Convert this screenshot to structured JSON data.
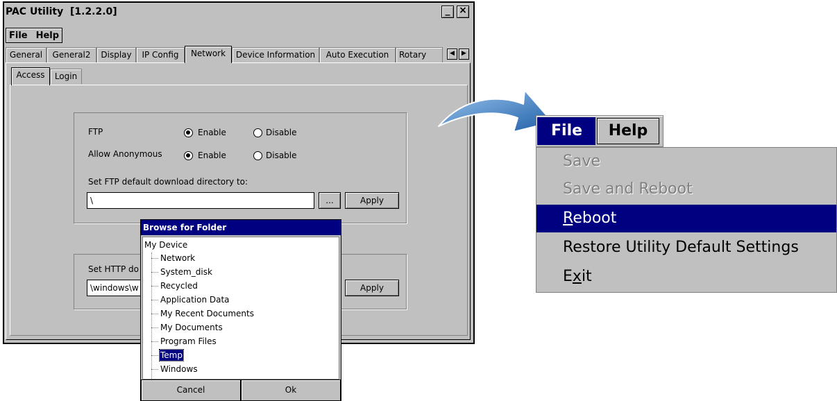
{
  "window": {
    "title": "PAC Utility  [1.2.2.0]",
    "minimize_glyph": "_",
    "close_glyph": "×"
  },
  "menubar": {
    "file": "File",
    "help": "Help"
  },
  "tabs": [
    {
      "label": "General",
      "active": false
    },
    {
      "label": "General2",
      "active": false
    },
    {
      "label": "Display",
      "active": false
    },
    {
      "label": "IP Config",
      "active": false
    },
    {
      "label": "Network",
      "active": true
    },
    {
      "label": "Device Information",
      "active": false
    },
    {
      "label": "Auto Execution",
      "active": false
    },
    {
      "label": "Rotary Exe",
      "active": false
    }
  ],
  "tab_scroll": {
    "left_glyph": "◀",
    "right_glyph": "▶"
  },
  "subtabs": [
    {
      "label": "Access",
      "active": true
    },
    {
      "label": "Login",
      "active": false
    }
  ],
  "ftp_group": {
    "ftp_label": "FTP",
    "anon_label": "Allow Anonymous",
    "enable_label": "Enable",
    "disable_label": "Disable",
    "ftp_enabled": true,
    "anonymous_enabled": true,
    "dir_label": "Set FTP default download directory to:",
    "dir_value": "\\",
    "browse_label": "...",
    "apply_label": "Apply"
  },
  "http_group": {
    "dir_label": "Set HTTP do",
    "dir_value": "\\windows\\w",
    "apply_label": "Apply"
  },
  "browse_dialog": {
    "title": "Browse for Folder",
    "root": "My Device",
    "items": [
      "Network",
      "System_disk",
      "Recycled",
      "Application Data",
      "My Recent Documents",
      "My Documents",
      "Program Files",
      "Temp",
      "Windows"
    ],
    "selected": "Temp",
    "cancel_label": "Cancel",
    "ok_label": "Ok"
  },
  "zoomed_menu": {
    "file_label": "File",
    "help_label": "Help",
    "items": [
      {
        "label": "Save",
        "state": "disabled"
      },
      {
        "label": "Save and Reboot",
        "state": "disabled"
      },
      {
        "label": "Reboot",
        "state": "highlighted",
        "mnemonic": "R"
      },
      {
        "label": "Restore Utility Default Settings",
        "state": "enabled"
      },
      {
        "label": "Exit",
        "state": "enabled",
        "mnemonic": "x"
      }
    ]
  },
  "colors": {
    "face": "#c0c0c0",
    "selection": "#000080",
    "arrow_light": "#7fb2e5",
    "arrow_dark": "#1f5fa8"
  },
  "icons": {
    "annotation_arrow": "curved-arrow-icon"
  }
}
